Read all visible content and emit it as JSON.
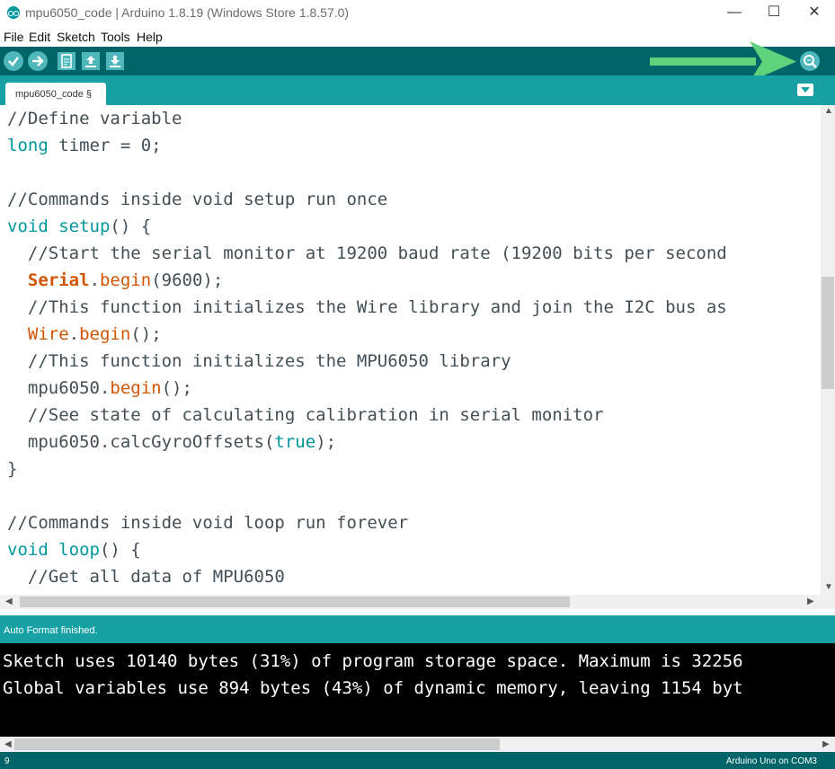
{
  "window": {
    "title": "mpu6050_code | Arduino 1.8.19 (Windows Store 1.8.57.0)",
    "minimize_glyph": "—",
    "maximize_glyph": "☐",
    "close_glyph": "✕"
  },
  "menu": [
    "File",
    "Edit",
    "Sketch",
    "Tools",
    "Help"
  ],
  "toolbar": {
    "icons": [
      "verify-icon",
      "upload-icon",
      "new-icon",
      "open-icon",
      "save-icon",
      "serial-monitor-icon"
    ]
  },
  "tabs": [
    {
      "label": "mpu6050_code §"
    }
  ],
  "editor": {
    "lines": [
      [
        {
          "t": "//Define variable",
          "c": "comment"
        }
      ],
      [
        {
          "t": "long",
          "c": "type"
        },
        {
          "t": " timer = 0;",
          "c": "plain"
        }
      ],
      [],
      [
        {
          "t": "//Commands inside void setup run once",
          "c": "comment"
        }
      ],
      [
        {
          "t": "void",
          "c": "type"
        },
        {
          "t": " ",
          "c": "plain"
        },
        {
          "t": "setup",
          "c": "type"
        },
        {
          "t": "() {",
          "c": "plain"
        }
      ],
      [
        {
          "t": "  //Start the serial monitor at 19200 baud rate (19200 bits per second",
          "c": "comment"
        }
      ],
      [
        {
          "t": "  ",
          "c": "plain"
        },
        {
          "t": "Serial",
          "c": "obj"
        },
        {
          "t": ".",
          "c": "plain"
        },
        {
          "t": "begin",
          "c": "fn"
        },
        {
          "t": "(9600);",
          "c": "plain"
        }
      ],
      [
        {
          "t": "  //This function initializes the Wire library and join the I2C bus as",
          "c": "comment"
        }
      ],
      [
        {
          "t": "  ",
          "c": "plain"
        },
        {
          "t": "Wire",
          "c": "fn"
        },
        {
          "t": ".",
          "c": "plain"
        },
        {
          "t": "begin",
          "c": "fn"
        },
        {
          "t": "();",
          "c": "plain"
        }
      ],
      [
        {
          "t": "  //This function initializes the MPU6050 library",
          "c": "comment"
        }
      ],
      [
        {
          "t": "  mpu6050.",
          "c": "plain"
        },
        {
          "t": "begin",
          "c": "fn"
        },
        {
          "t": "();",
          "c": "plain"
        }
      ],
      [
        {
          "t": "  //See state of calculating calibration in serial monitor",
          "c": "comment"
        }
      ],
      [
        {
          "t": "  mpu6050.calcGyroOffsets(",
          "c": "plain"
        },
        {
          "t": "true",
          "c": "lit"
        },
        {
          "t": ");",
          "c": "plain"
        }
      ],
      [
        {
          "t": "}",
          "c": "plain"
        }
      ],
      [],
      [
        {
          "t": "//Commands inside void loop run forever",
          "c": "comment"
        }
      ],
      [
        {
          "t": "void",
          "c": "type"
        },
        {
          "t": " ",
          "c": "plain"
        },
        {
          "t": "loop",
          "c": "type"
        },
        {
          "t": "() {",
          "c": "plain"
        }
      ],
      [
        {
          "t": "  //Get all data of MPU6050",
          "c": "comment"
        }
      ]
    ]
  },
  "status": {
    "message": "Auto Format finished."
  },
  "console": {
    "lines": [
      "Sketch uses 10140 bytes (31%) of program storage space. Maximum is 32256",
      "Global variables use 894 bytes (43%) of dynamic memory, leaving 1154 byt"
    ]
  },
  "footer": {
    "line_number": "9",
    "board": "Arduino Uno on COM3"
  },
  "colors": {
    "toolbar": "#006468",
    "tabstrip": "#17a1a5",
    "button": "#4db7bb",
    "annotation_arrow": "#5fd37c"
  }
}
